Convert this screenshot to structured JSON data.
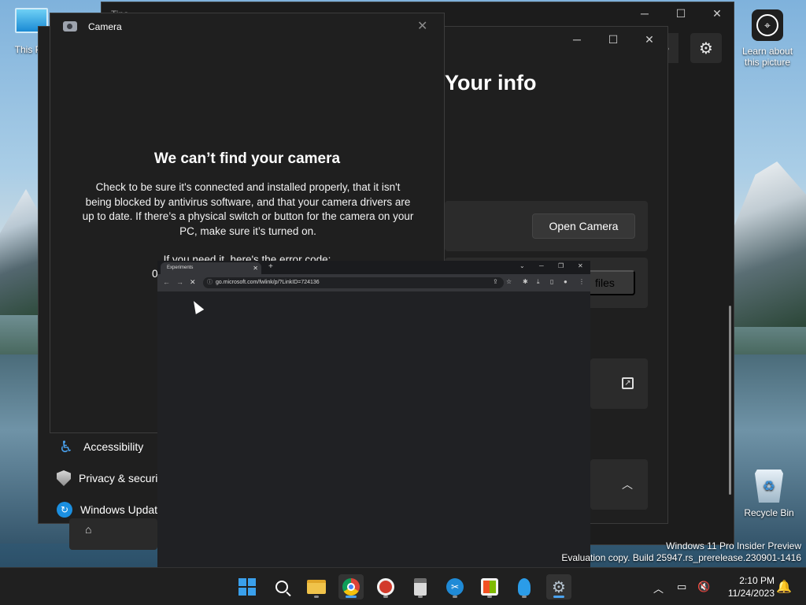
{
  "desktop": {
    "icons": [
      {
        "label": "This PC"
      },
      {
        "label": "Learn about this picture"
      },
      {
        "label": "Recycle Bin"
      }
    ],
    "watermark_line1": "Windows 11 Pro Insider Preview",
    "watermark_line2": "Evaluation copy. Build 25947.rs_prerelease.230901-1416"
  },
  "tips_window": {
    "title": "Tips"
  },
  "settings_window": {
    "heading": "Your info",
    "open_camera_label": "Open Camera",
    "files_label": "files",
    "nav": [
      {
        "label": "Accessibility"
      },
      {
        "label": "Privacy & security"
      },
      {
        "label": "Windows Update"
      }
    ]
  },
  "camera_window": {
    "title": "Camera",
    "heading": "We can’t find your camera",
    "body": "Check to be sure it's connected and installed properly, that it isn't being blocked by antivirus software, and that your camera drivers are up to date. If there’s a physical switch or button for the camera on your PC, make sure it’s turned on.",
    "error_intro": "If you need it, here's the error code:",
    "error_code": "0"
  },
  "browser": {
    "tab_title": "Experiments",
    "url": "go.microsoft.com/fwlink/p/?LinkID=724136"
  },
  "taskbar": {
    "time": "2:10 PM",
    "date": "11/24/2023",
    "apps": [
      "start",
      "search",
      "file-explorer",
      "chrome",
      "ccleaner",
      "calculator",
      "snipping-tool",
      "microsoft-store",
      "tips",
      "settings"
    ]
  }
}
